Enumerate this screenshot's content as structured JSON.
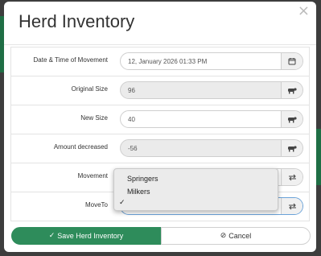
{
  "modal": {
    "title": "Herd Inventory",
    "close_symbol": "×"
  },
  "form": {
    "rows": [
      {
        "label": "Date & Time of Movement",
        "value": "12, January 2026 01:33 PM",
        "icon": "calendar-icon"
      },
      {
        "label": "Original Size",
        "value": "96",
        "icon": "cow-icon"
      },
      {
        "label": "New Size",
        "value": "40",
        "icon": "cow-icon"
      },
      {
        "label": "Amount decreased",
        "value": "-56",
        "icon": "cow-icon"
      },
      {
        "label": "Movement",
        "value": "",
        "icon": "swap-arrows-icon"
      },
      {
        "label": "MoveTo",
        "value": "",
        "icon": "swap-arrows-icon"
      }
    ]
  },
  "dropdown": {
    "options": [
      "Springers",
      "Milkers",
      ""
    ],
    "selected_index": 2,
    "check_symbol": "✓"
  },
  "footer": {
    "save_label": "Save Herd Inventory",
    "cancel_label": "Cancel"
  },
  "colors": {
    "primary": "#2e8c5b",
    "backdrop": "#3d3d3d"
  }
}
